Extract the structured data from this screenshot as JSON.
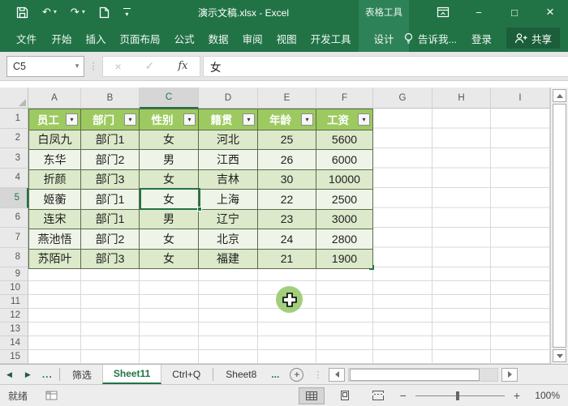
{
  "titlebar": {
    "title": "演示文稿.xlsx - Excel",
    "context_group": "表格工具"
  },
  "ribbon": {
    "tabs": [
      "文件",
      "开始",
      "插入",
      "页面布局",
      "公式",
      "数据",
      "审阅",
      "视图",
      "开发工具",
      "设计"
    ],
    "active_tab": "设计",
    "tell_me": "告诉我...",
    "sign_in": "登录",
    "share": "共享"
  },
  "formula_bar": {
    "name_box": "C5",
    "fx": "fx",
    "value": "女"
  },
  "grid": {
    "columns": [
      "A",
      "B",
      "C",
      "D",
      "E",
      "F",
      "G",
      "H",
      "I"
    ],
    "rows": [
      "1",
      "2",
      "3",
      "4",
      "5",
      "6",
      "7",
      "8",
      "9",
      "10",
      "11",
      "12",
      "13",
      "14",
      "15"
    ],
    "selected_cell": "C5",
    "selected_column": "C",
    "selected_row": "5"
  },
  "table": {
    "headers": [
      "员工",
      "部门",
      "性别",
      "籍贯",
      "年龄",
      "工资"
    ],
    "rows": [
      [
        "白凤九",
        "部门1",
        "女",
        "河北",
        "25",
        "5600"
      ],
      [
        "东华",
        "部门2",
        "男",
        "江西",
        "26",
        "6000"
      ],
      [
        "折颜",
        "部门3",
        "女",
        "吉林",
        "30",
        "10000"
      ],
      [
        "姬蘅",
        "部门1",
        "女",
        "上海",
        "22",
        "2500"
      ],
      [
        "连宋",
        "部门1",
        "男",
        "辽宁",
        "23",
        "3000"
      ],
      [
        "燕池悟",
        "部门2",
        "女",
        "北京",
        "24",
        "2800"
      ],
      [
        "苏陌叶",
        "部门3",
        "女",
        "福建",
        "21",
        "1900"
      ]
    ]
  },
  "sheetbar": {
    "tabs": [
      "筛选",
      "Sheet11",
      "Ctrl+Q",
      "Sheet8"
    ],
    "active_tab": "Sheet11"
  },
  "statusbar": {
    "mode": "就绪",
    "zoom": "100%"
  },
  "icons": {
    "dropdown_arrow": "▾",
    "filter_arrow": "▾",
    "undo": "↶",
    "redo": "↷",
    "minimize": "−",
    "maximize": "□",
    "close": "×",
    "cancel": "×",
    "enter": "✓",
    "dots": "⋮",
    "ellipsis": "...",
    "nav_left": "◀",
    "nav_right": "▶",
    "plus": "+",
    "minus": "−"
  },
  "colors": {
    "accent_green": "#217346",
    "context_green": "#2e8257",
    "table_header_green": "#9cca60",
    "band_dark": "#dce9ca",
    "band_light": "#eef4e7",
    "gridline": "#d9d9d9"
  }
}
